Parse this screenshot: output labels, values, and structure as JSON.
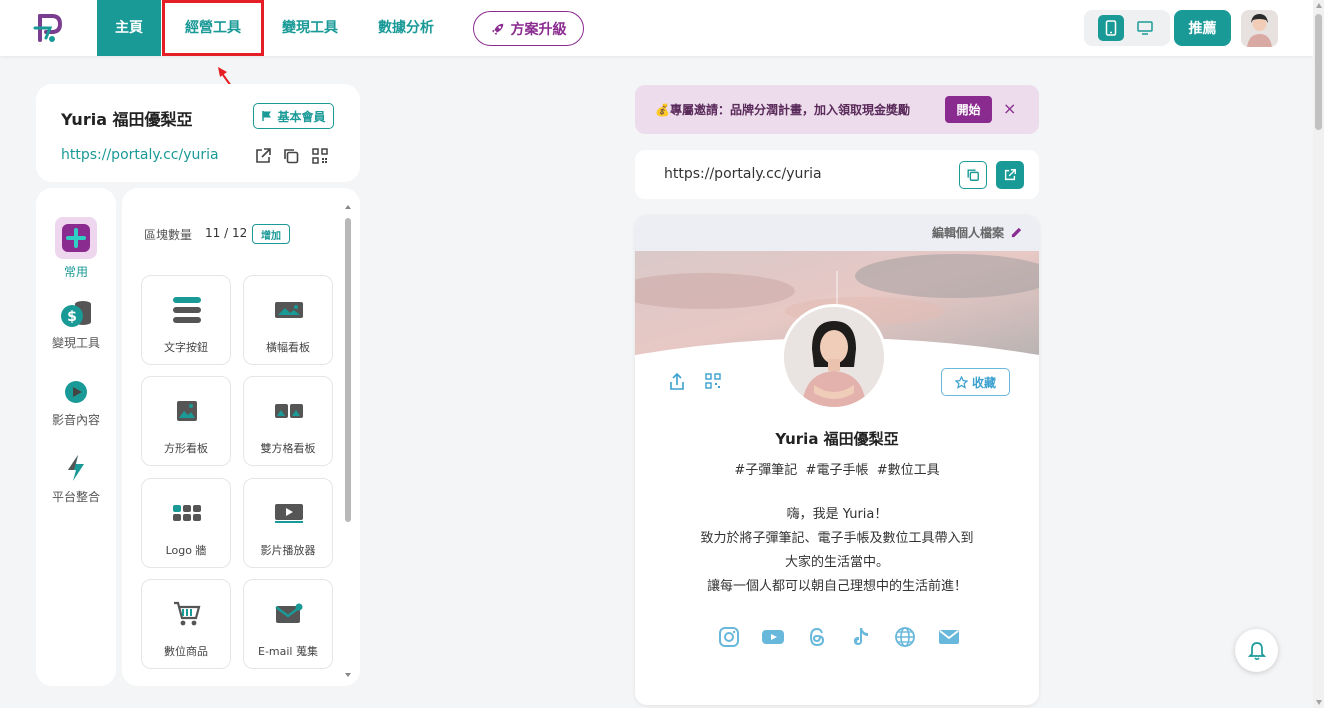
{
  "nav": {
    "home": "主頁",
    "operations": "經營工具",
    "monetize": "變現工具",
    "analytics": "數據分析",
    "upgrade": "方案升級",
    "recommend": "推薦"
  },
  "profile": {
    "name": "Yuria 福田優梨亞",
    "member_level": "基本會員",
    "url": "https://portaly.cc/yuria"
  },
  "rail": [
    {
      "label": "常用",
      "icon": "plus-icon",
      "active": true
    },
    {
      "label": "變現工具",
      "icon": "money-stack-icon"
    },
    {
      "label": "影音內容",
      "icon": "play-icon"
    },
    {
      "label": "平台整合",
      "icon": "lightning-icon"
    }
  ],
  "blocks": {
    "count_label": "區塊數量",
    "count_value": "11 / 12",
    "add_label": "增加",
    "tiles": [
      {
        "label": "文字按鈕",
        "icon": "text-button-icon"
      },
      {
        "label": "橫幅看板",
        "icon": "banner-image-icon"
      },
      {
        "label": "方形看板",
        "icon": "square-image-icon"
      },
      {
        "label": "雙方格看板",
        "icon": "double-square-icon"
      },
      {
        "label": "Logo 牆",
        "icon": "logo-wall-icon"
      },
      {
        "label": "影片播放器",
        "icon": "video-player-icon"
      },
      {
        "label": "數位商品",
        "icon": "cart-icon"
      },
      {
        "label": "E-mail 蒐集",
        "icon": "mail-icon"
      }
    ]
  },
  "invite": {
    "text": "💰專屬邀請：品牌分潤計畫，加入領取現金獎勵",
    "button": "開始",
    "close": "×"
  },
  "preview": {
    "url": "https://portaly.cc/yuria",
    "edit_label": "編輯個人檔案",
    "favorite_label": "收藏",
    "name": "Yuria 福田優梨亞",
    "tags": "#子彈筆記  #電子手帳  #數位工具",
    "bio": [
      "嗨，我是 Yuria！",
      "致力於將子彈筆記、電子手帳及數位工具帶入到",
      "大家的生活當中。",
      "讓每一個人都可以朝自己理想中的生活前進！"
    ],
    "socials": [
      "instagram-icon",
      "youtube-icon",
      "threads-icon",
      "tiktok-icon",
      "globe-icon",
      "email-icon"
    ]
  },
  "colors": {
    "primary": "#1a9a97",
    "accent": "#8a2b8f",
    "highlight": "#e51e25",
    "social": "#68b8dc"
  }
}
